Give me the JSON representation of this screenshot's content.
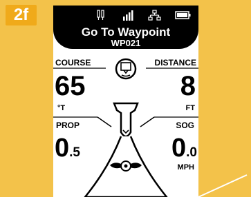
{
  "badge": "2f",
  "header": {
    "title": "Go To Waypoint",
    "subtitle": "WP021",
    "icons": [
      "gps-antenna-icon",
      "signal-bars-icon",
      "network-icon",
      "battery-icon"
    ]
  },
  "course": {
    "label": "COURSE",
    "value": "65",
    "unit": "°T"
  },
  "distance": {
    "label": "DISTANCE",
    "value": "8",
    "unit": "FT"
  },
  "prop": {
    "label": "PROP",
    "value_int": "0",
    "value_dec": ".5"
  },
  "sog": {
    "label": "SOG",
    "value_int": "0",
    "value_dec": ".0",
    "unit": "MPH"
  },
  "colors": {
    "frame": "#f3c24a",
    "badge": "#f0aa1a",
    "screen": "#ffffff",
    "header": "#000000"
  }
}
